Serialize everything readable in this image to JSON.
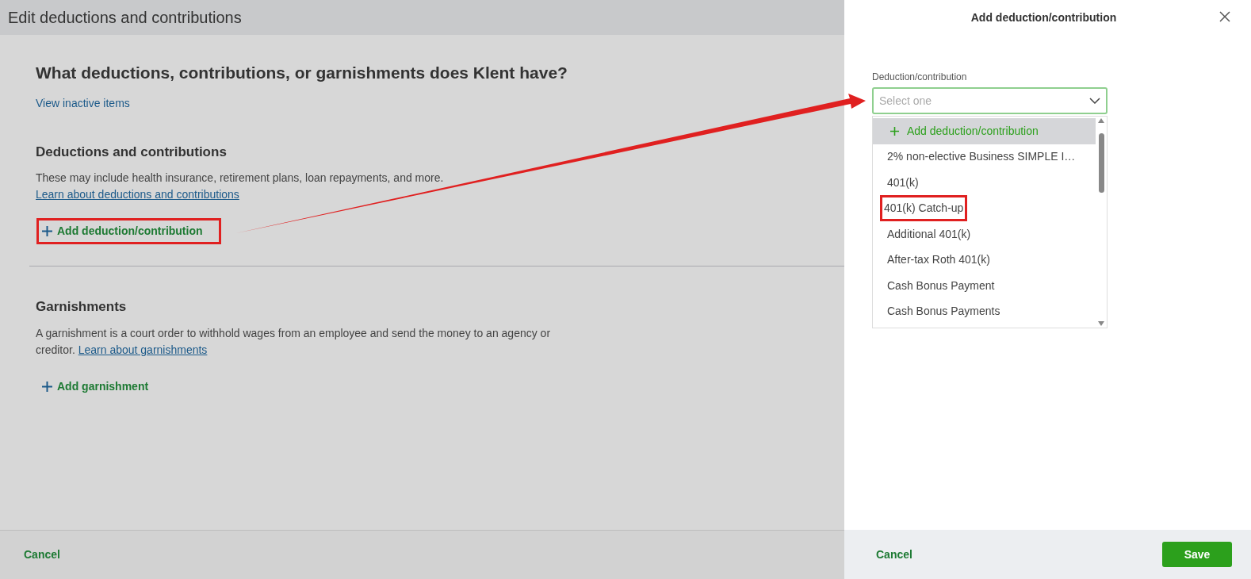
{
  "page": {
    "title": "Edit deductions and contributions",
    "question": "What deductions, contributions, or garnishments does Klent have?",
    "inactive_link": "View inactive items"
  },
  "sections": [
    {
      "heading": "Deductions and contributions",
      "description": "These may include health insurance, retirement plans, loan repayments, and more.",
      "learn_link": "Learn about deductions and contributions",
      "link_on_new_line": true,
      "add_label": "Add deduction/contribution",
      "annotated": true
    },
    {
      "heading": "Garnishments",
      "description": "A garnishment is a court order to withhold wages from an employee and send the money to an agency or creditor.",
      "learn_link": "Learn about garnishments",
      "link_on_new_line": false,
      "add_label": "Add garnishment",
      "annotated": false
    }
  ],
  "footer": {
    "cancel": "Cancel"
  },
  "panel": {
    "title": "Add deduction/contribution",
    "field_label": "Deduction/contribution",
    "placeholder": "Select one",
    "options": [
      {
        "kind": "add",
        "label": "Add deduction/contribution",
        "selected": true,
        "annotated": false
      },
      {
        "kind": "option",
        "label": "2% non-elective Business SIMPLE I…",
        "selected": false,
        "annotated": false
      },
      {
        "kind": "option",
        "label": "401(k)",
        "selected": false,
        "annotated": false
      },
      {
        "kind": "option",
        "label": "401(k) Catch-up",
        "selected": false,
        "annotated": true
      },
      {
        "kind": "option",
        "label": "Additional 401(k)",
        "selected": false,
        "annotated": false
      },
      {
        "kind": "option",
        "label": "After-tax Roth 401(k)",
        "selected": false,
        "annotated": false
      },
      {
        "kind": "option",
        "label": "Cash Bonus Payment",
        "selected": false,
        "annotated": false
      },
      {
        "kind": "option",
        "label": "Cash Bonus Payments",
        "selected": false,
        "annotated": false
      }
    ],
    "cancel": "Cancel",
    "save": "Save"
  }
}
